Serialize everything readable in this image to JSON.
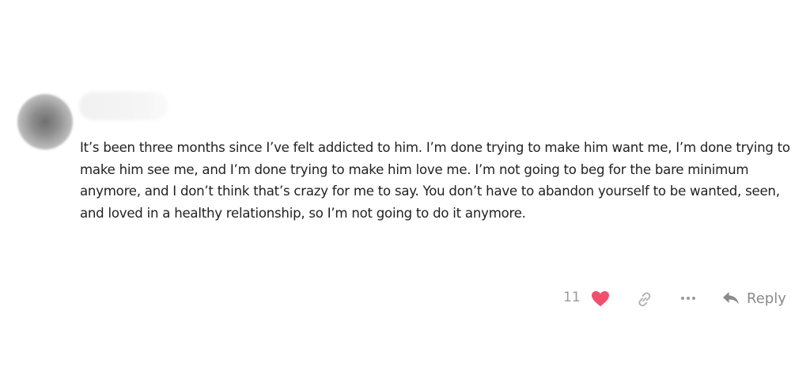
{
  "comment": {
    "body": "It’s been three months since I’ve felt addicted to him. I’m done trying to make him want me, I’m done trying to make him see me, and I’m done trying to make him love me. I’m not going to beg for the bare minimum anymore, and I don’t think that’s crazy for me to say. You don’t have to abandon yourself to be wanted, seen, and loved in a healthy relationship, so I’m not going to do it anymore.",
    "like_count": "11",
    "reply_label": "Reply"
  },
  "icons": {
    "avatar": "blurred-avatar",
    "username": "blurred-username",
    "like": "heart-icon",
    "link": "link-icon",
    "more": "ellipsis-icon",
    "reply": "reply-arrow-icon"
  },
  "colors": {
    "heart": "#f0506e",
    "muted": "#9a9a9a",
    "text": "#222222"
  }
}
